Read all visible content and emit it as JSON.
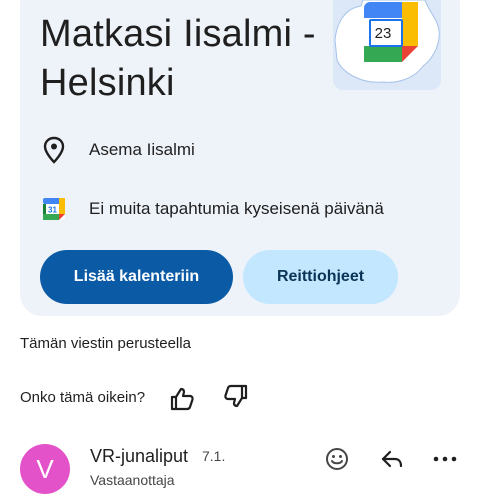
{
  "event_card": {
    "title": "Matkasi Iisalmi - Helsinki",
    "location": "Asema Iisalmi",
    "calendar_note": "Ei muita tapahtumia kyseisenä päivänä",
    "calendar_day": "23",
    "calendar_icon_day": "31",
    "add_to_calendar_label": "Lisää kalenteriin",
    "directions_label": "Reittiohjeet",
    "colors": {
      "card_bg": "#eef2f9",
      "primary": "#0b5aa6",
      "secondary": "#c2e7ff"
    }
  },
  "based_on_text": "Tämän viestin perusteella",
  "feedback": {
    "question": "Onko tämä oikein?",
    "like_icon": "thumbs-up-icon",
    "dislike_icon": "thumbs-down-icon"
  },
  "message": {
    "avatar_letter": "V",
    "avatar_color": "#e352c9",
    "sender": "VR-junaliput",
    "date": "7.1.",
    "preview": "Vastaanottaja",
    "actions": [
      "emoji-icon",
      "reply-icon",
      "more-icon"
    ]
  }
}
